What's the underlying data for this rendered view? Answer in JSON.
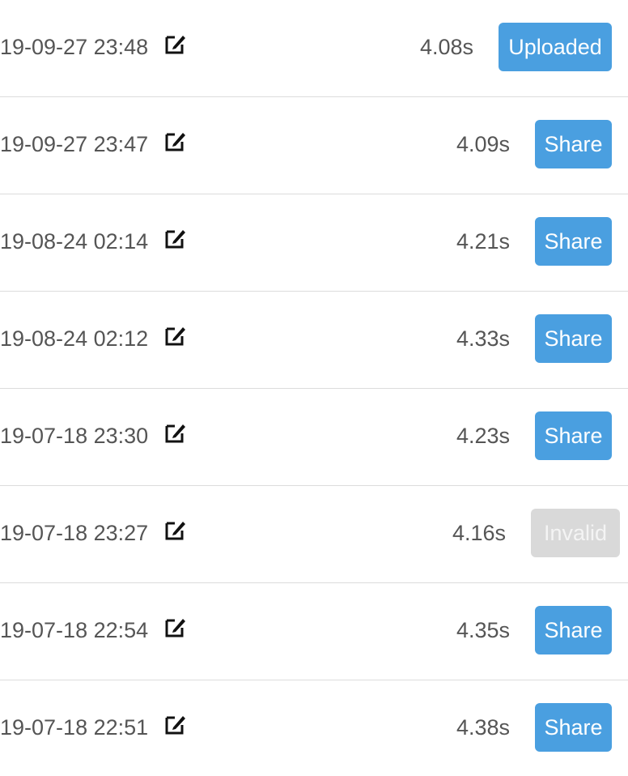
{
  "records": [
    {
      "date": "19-09-27 23:48",
      "time": "4.08s",
      "button": "Uploaded",
      "kind": "uploaded"
    },
    {
      "date": "19-09-27 23:47",
      "time": "4.09s",
      "button": "Share",
      "kind": "share"
    },
    {
      "date": "19-08-24 02:14",
      "time": "4.21s",
      "button": "Share",
      "kind": "share"
    },
    {
      "date": "19-08-24 02:12",
      "time": "4.33s",
      "button": "Share",
      "kind": "share"
    },
    {
      "date": "19-07-18 23:30",
      "time": "4.23s",
      "button": "Share",
      "kind": "share"
    },
    {
      "date": "19-07-18 23:27",
      "time": "4.16s",
      "button": "Invalid",
      "kind": "invalid"
    },
    {
      "date": "19-07-18 22:54",
      "time": "4.35s",
      "button": "Share",
      "kind": "share"
    },
    {
      "date": "19-07-18 22:51",
      "time": "4.38s",
      "button": "Share",
      "kind": "share"
    }
  ],
  "icons": {
    "edit": "edit-icon"
  },
  "colors": {
    "primary": "#4a9fe0",
    "disabled": "#d9d9d9",
    "text": "#555555"
  }
}
